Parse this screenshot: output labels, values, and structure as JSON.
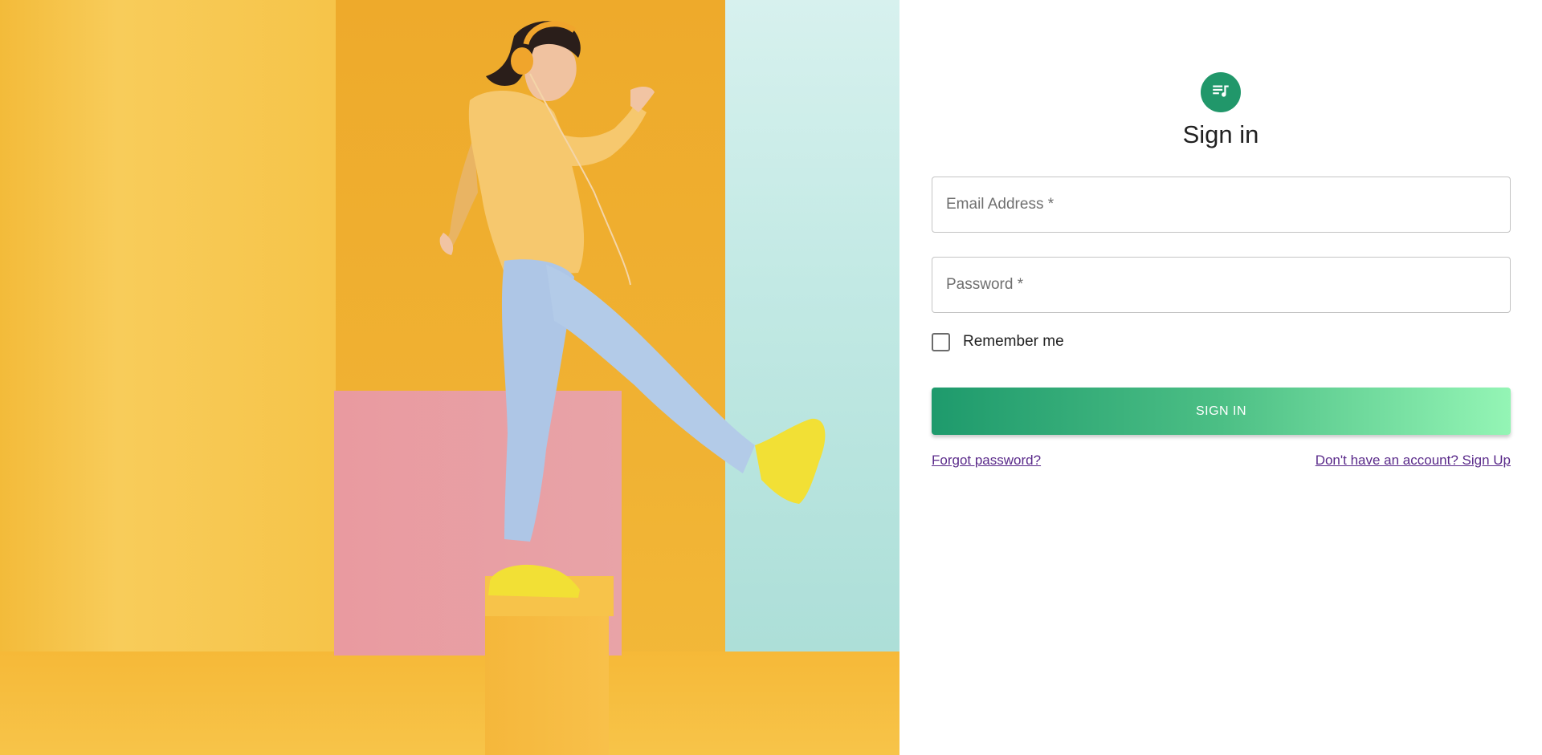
{
  "hero": {
    "image_description_icon": "woman-dancing-headphones-illustration"
  },
  "signin": {
    "avatar_icon": "music-playlist-icon",
    "title": "Sign in",
    "email_placeholder": "Email Address *",
    "password_placeholder": "Password *",
    "remember_label": "Remember me",
    "submit_label": "SIGN IN",
    "forgot_link": "Forgot password?",
    "signup_link": "Don't have an account? Sign Up"
  },
  "colors": {
    "accent": "#21976a",
    "button_gradient_start": "#1e9a6c",
    "button_gradient_end": "#94f5b5",
    "link": "#5a2a8a"
  }
}
